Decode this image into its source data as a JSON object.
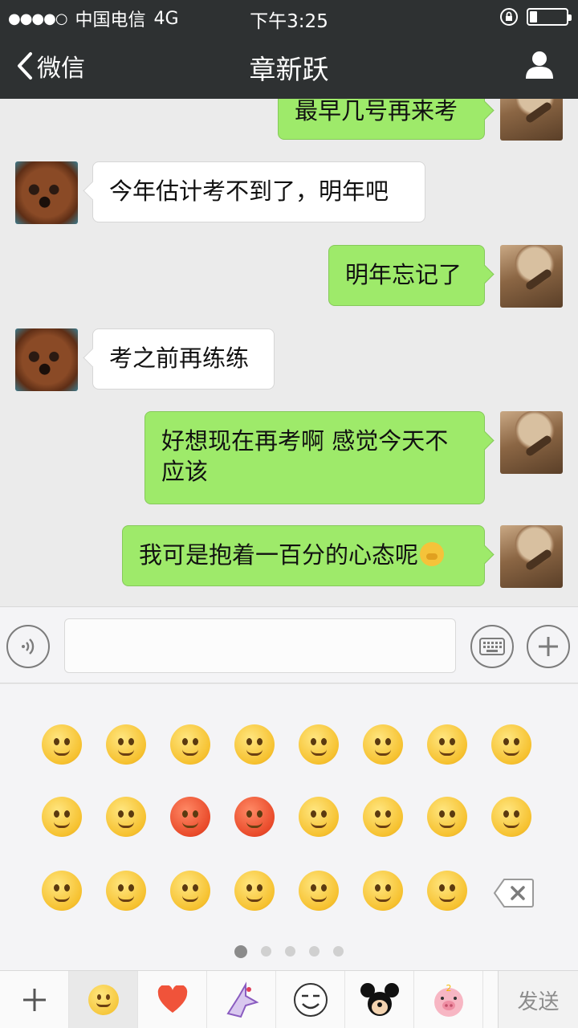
{
  "status_bar": {
    "signal": "●●●●○",
    "carrier": "中国电信",
    "network": "4G",
    "time": "下午3:25",
    "battery_level": 0.2
  },
  "nav": {
    "back_label": "微信",
    "title": "章新跃"
  },
  "messages": [
    {
      "dir": "out",
      "text": "最早几号再来考",
      "avatar": "sisyphus-avatar"
    },
    {
      "dir": "in",
      "text": "今年估计考不到了，明年吧",
      "avatar": "dog-avatar"
    },
    {
      "dir": "out",
      "text": "明年忘记了",
      "avatar": "sisyphus-avatar"
    },
    {
      "dir": "in",
      "text": "考之前再练练",
      "avatar": "dog-avatar"
    },
    {
      "dir": "out",
      "text": "好想现在再考啊 感觉今天不应该",
      "avatar": "sisyphus-avatar"
    },
    {
      "dir": "out",
      "text": "我可是抱着一百分的心态呢",
      "avatar": "sisyphus-avatar",
      "emoji": "thinking-emoji"
    }
  ],
  "input": {
    "value": "",
    "placeholder": ""
  },
  "emoji_panel": {
    "page_count": 5,
    "current_page": 1
  },
  "tabs": [
    "add-tab",
    "emoji-tab",
    "favorite-heart-tab",
    "sticker-pack-1",
    "sticker-pack-2",
    "mickey-sticker-pack",
    "pig-sticker-pack"
  ],
  "send_label": "发送",
  "colors": {
    "nav_bg": "#2e3132",
    "out_bubble": "#9eea6a",
    "in_bubble": "#ffffff",
    "chat_bg": "#ebebeb"
  }
}
